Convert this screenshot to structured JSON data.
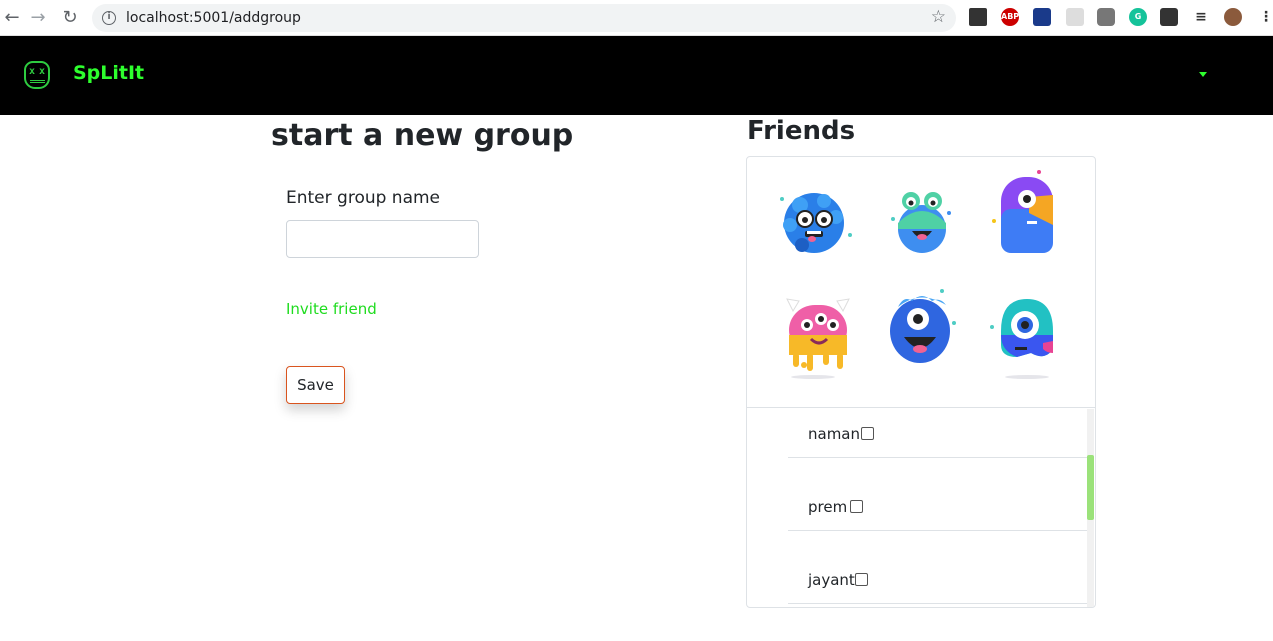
{
  "browser": {
    "url": "localhost:5001/addgroup",
    "icons": [
      "back-icon",
      "forward-icon",
      "reload-icon",
      "info-icon",
      "bookmark-star-icon",
      "extension-icons",
      "profile-avatar",
      "menu-icon"
    ]
  },
  "navbar": {
    "brand": "SpLitIt",
    "brand_color": "#2eff2e",
    "background": "#000000"
  },
  "form": {
    "title": "start a new group",
    "group_name_label": "Enter group name",
    "group_name_value": "",
    "invite_link": "Invite friend",
    "save_label": "Save"
  },
  "friends": {
    "title": "Friends",
    "list": [
      {
        "name": "naman",
        "checked": false
      },
      {
        "name": "prem",
        "checked": false
      },
      {
        "name": "jayant",
        "checked": false
      }
    ]
  }
}
